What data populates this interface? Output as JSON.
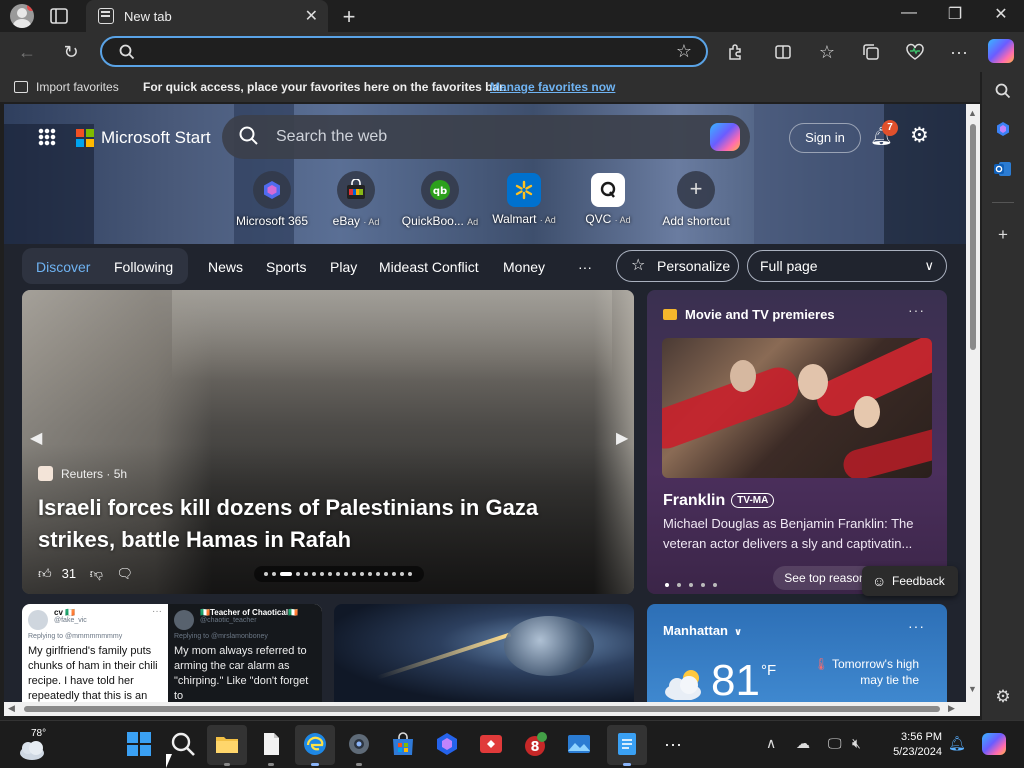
{
  "browser": {
    "tab_title": "New tab",
    "tab_close": "✕",
    "new_tab": "+",
    "window": {
      "minimize": "—",
      "restore": "❐",
      "close": "✕"
    },
    "address_placeholder": "",
    "favorites_bar": {
      "import_label": "Import favorites",
      "message": "For quick access, place your favorites here on the favorites bar.",
      "manage_link": "Manage favorites now"
    }
  },
  "msn": {
    "brand": "Microsoft Start",
    "search_placeholder": "Search the web",
    "sign_in": "Sign in",
    "notification_count": "7",
    "shortcuts": [
      {
        "label": "Microsoft 365",
        "ad": ""
      },
      {
        "label": "eBay",
        "ad": "· Ad"
      },
      {
        "label": "QuickBoo...",
        "ad": "Ad"
      },
      {
        "label": "Walmart",
        "ad": "· Ad"
      },
      {
        "label": "QVC",
        "ad": "· Ad"
      },
      {
        "label": "Add shortcut",
        "ad": ""
      }
    ],
    "nav": {
      "discover": "Discover",
      "following": "Following",
      "items": [
        "News",
        "Sports",
        "Play",
        "Mideast Conflict",
        "Money"
      ],
      "more": "···",
      "personalize": "Personalize",
      "layout": "Full page"
    },
    "top_story": {
      "source": "Reuters",
      "age": "5h",
      "headline": "Israeli forces kill dozens of Palestinians in Gaza strikes, battle Hamas in Rafah",
      "likes": "31"
    },
    "movie_card": {
      "heading": "Movie and TV premieres",
      "title": "Franklin",
      "rating": "TV-MA",
      "description": "Michael Douglas as Benjamin Franklin: The veteran actor delivers a sly and captivatin...",
      "button": "See top reasons to watch"
    },
    "tweets": [
      {
        "name": "cv 🇮🇪",
        "handle": "@fake_vic",
        "reply": "Replying to @mmmmmmmmy",
        "text": "My girlfriend's family puts chunks of ham in their chili recipe. I have told her repeatedly that this is an"
      },
      {
        "name": "🇮🇪Teacher of Chaotical🇮🇪",
        "handle": "@chaotic_teacher",
        "reply": "Replying to @mrslamonboney",
        "text": "My mom always referred to arming the car alarm as \"chirping.\" Like \"don't forget to"
      }
    ],
    "weather": {
      "location": "Manhattan",
      "temperature": "81",
      "unit": "°F",
      "tip": "Tomorrow's high may tie the"
    },
    "feedback": "Feedback"
  },
  "taskbar": {
    "weather_temp": "78°",
    "time": "3:56 PM",
    "date": "5/23/2024"
  },
  "colors": {
    "accent": "#6fb3f2",
    "address_border": "#5aa3e6",
    "notification_badge": "#e0502c"
  }
}
